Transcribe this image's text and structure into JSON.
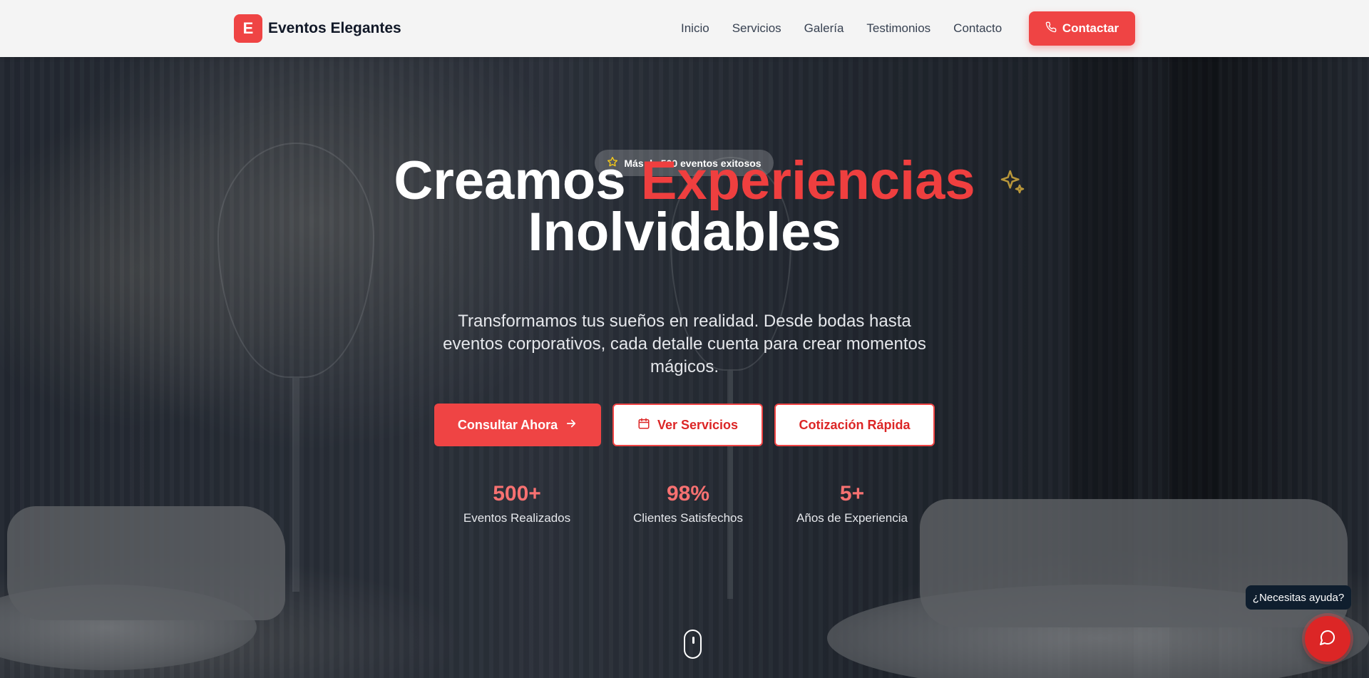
{
  "brand": {
    "mark": "E",
    "name": "Eventos Elegantes"
  },
  "nav": {
    "items": [
      "Inicio",
      "Servicios",
      "Galería",
      "Testimonios",
      "Contacto"
    ],
    "cta": "Contactar"
  },
  "hero": {
    "badge": "Más de 500 eventos exitosos",
    "title_part1": "Creamos",
    "title_accent": "Experiencias",
    "title_part2": "Inolvidables",
    "subtitle": "Transformamos tus sueños en realidad. Desde bodas hasta eventos corporativos, cada detalle cuenta para crear momentos mágicos.",
    "buttons": {
      "primary": "Consultar Ahora",
      "services": "Ver Servicios",
      "quote": "Cotización Rápida"
    },
    "stats": [
      {
        "value": "500+",
        "label": "Eventos Realizados"
      },
      {
        "value": "98%",
        "label": "Clientes Satisfechos"
      },
      {
        "value": "5+",
        "label": "Años de Experiencia"
      }
    ]
  },
  "chat": {
    "tooltip": "¿Necesitas ayuda?"
  },
  "icons": {
    "nav_cta": "phone-icon",
    "badge": "star-icon",
    "primary": "arrow-right-icon",
    "services": "calendar-icon",
    "chat": "chat-bubble-icon",
    "decor": "sparkles-icon"
  },
  "colors": {
    "accent": "#ef4444",
    "accent_dark": "#dc2626",
    "stat_value": "#f87171",
    "header_bg": "#f4f4f4",
    "tooltip_bg": "#0f1e2e"
  }
}
